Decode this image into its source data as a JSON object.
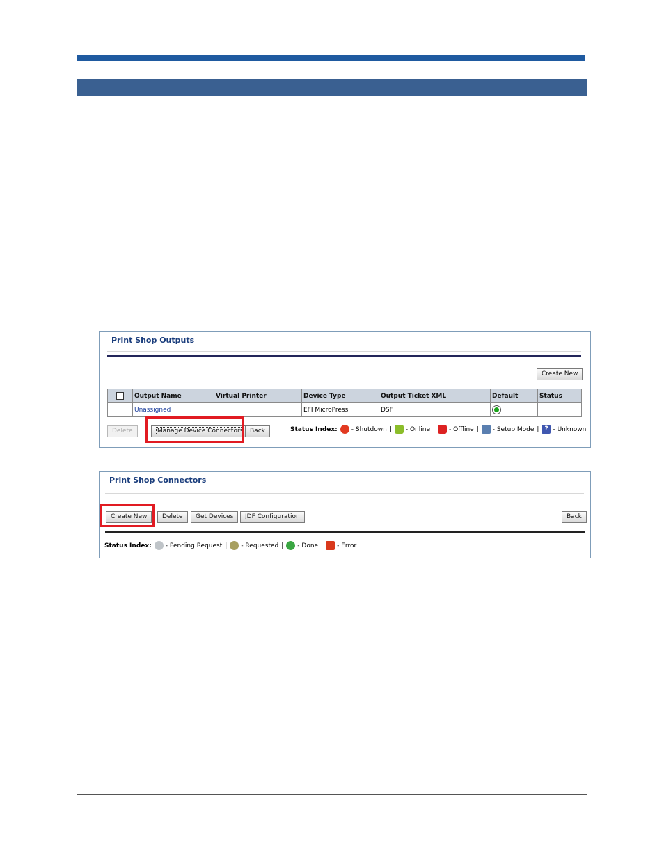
{
  "outputs": {
    "title": "Print Shop Outputs",
    "create_new": "Create New",
    "columns": [
      "Output Name",
      "Virtual Printer",
      "Device Type",
      "Output Ticket XML",
      "Default",
      "Status"
    ],
    "row": {
      "output_name": "Unassigned",
      "virtual_printer": "",
      "device_type": "EFI MicroPress",
      "ticket_xml": "DSF",
      "default_selected": true,
      "status": ""
    },
    "buttons": {
      "delete": "Delete",
      "manage": "Manage Device Connectors",
      "back": "Back"
    },
    "status_index": {
      "label": "Status Index:",
      "items": [
        {
          "icon": "shutdown-icon",
          "text": "- Shutdown"
        },
        {
          "icon": "online-icon",
          "text": "- Online"
        },
        {
          "icon": "offline-icon",
          "text": "- Offline"
        },
        {
          "icon": "setup-mode-icon",
          "text": "- Setup Mode"
        },
        {
          "icon": "unknown-icon",
          "text": "- Unknown"
        }
      ],
      "separator": "|"
    }
  },
  "connectors": {
    "title": "Print Shop Connectors",
    "buttons": {
      "create_new": "Create New",
      "delete": "Delete",
      "get_devices": "Get Devices",
      "jdf_config": "JDF Configuration",
      "back": "Back"
    },
    "status_index": {
      "label": "Status Index:",
      "items": [
        {
          "icon": "pending-request-icon",
          "text": "- Pending Request"
        },
        {
          "icon": "requested-icon",
          "text": "- Requested"
        },
        {
          "icon": "done-icon",
          "text": "- Done"
        },
        {
          "icon": "error-icon",
          "text": "- Error"
        }
      ],
      "separator": "|"
    }
  },
  "colors": {
    "accent": "#1f5aa0",
    "section_bar": "#3a6091",
    "highlight": "#e11b22",
    "title": "#1a3d7c"
  }
}
